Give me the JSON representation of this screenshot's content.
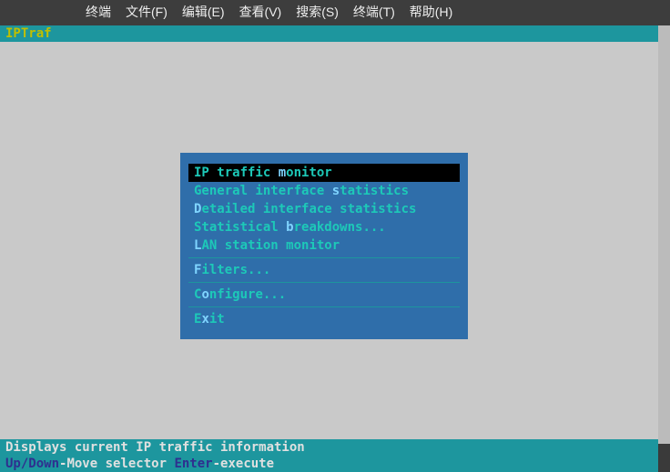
{
  "window": {
    "menubar": [
      "终端",
      "文件(F)",
      "编辑(E)",
      "查看(V)",
      "搜索(S)",
      "终端(T)",
      "帮助(H)"
    ]
  },
  "app": {
    "title": "IPTraf"
  },
  "menu": {
    "groups": [
      [
        {
          "pre": "IP traffic ",
          "key": "m",
          "post": "onitor",
          "selected": true
        },
        {
          "pre": "General interface ",
          "key": "s",
          "post": "tatistics",
          "selected": false
        },
        {
          "pre": "",
          "key": "D",
          "post": "etailed interface statistics",
          "selected": false
        },
        {
          "pre": "Statistical ",
          "key": "b",
          "post": "reakdowns...",
          "selected": false
        },
        {
          "pre": "",
          "key": "L",
          "post": "AN station monitor",
          "selected": false
        }
      ],
      [
        {
          "pre": "",
          "key": "F",
          "post": "ilters...",
          "selected": false
        }
      ],
      [
        {
          "pre": "C",
          "key": "o",
          "post": "nfigure...",
          "selected": false
        }
      ],
      [
        {
          "pre": "E",
          "key": "x",
          "post": "it",
          "selected": false
        }
      ]
    ]
  },
  "status": {
    "description": "Displays current IP traffic information",
    "hint1_key": "Up/Down",
    "hint1_txt": "-Move selector  ",
    "hint2_key": "Enter",
    "hint2_txt": "-execute"
  }
}
